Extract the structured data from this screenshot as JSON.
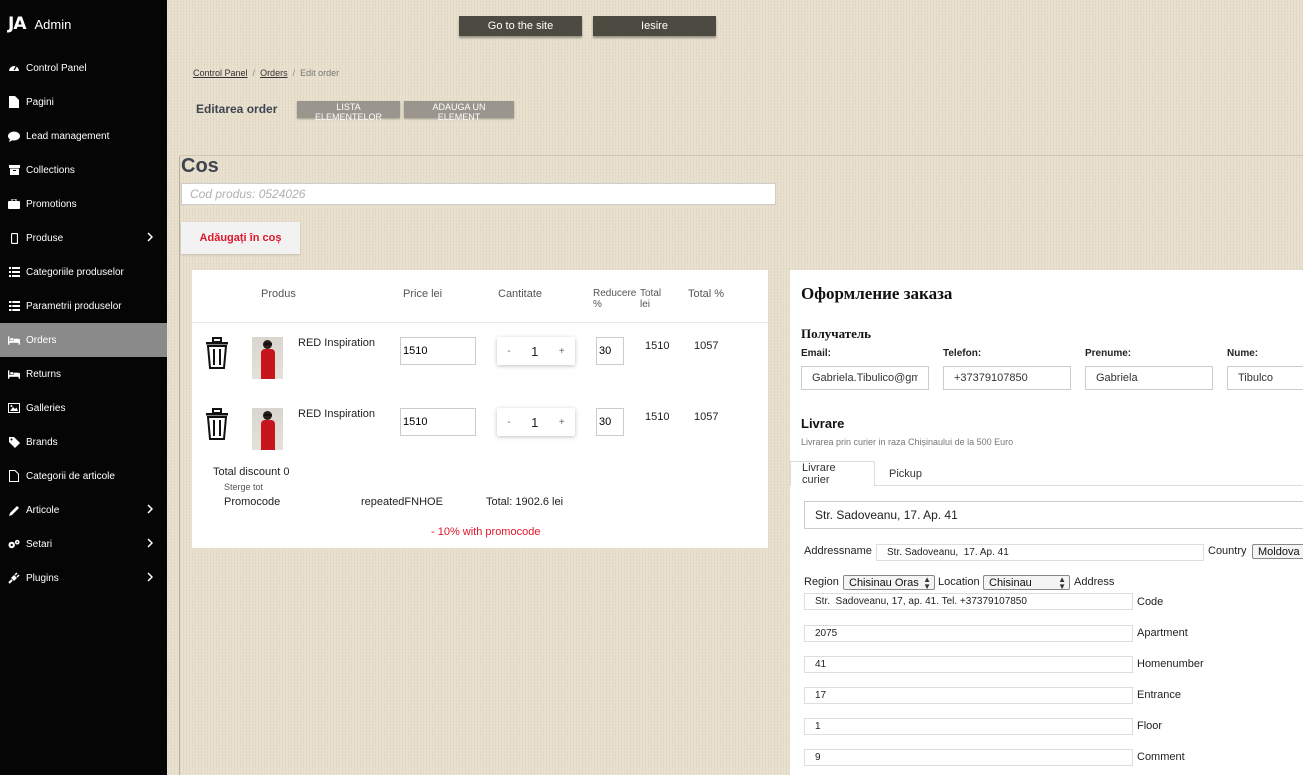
{
  "app": {
    "logo_mark": "JA",
    "title": "Admin"
  },
  "sidebar": {
    "items": [
      {
        "label": "Control Panel",
        "icon": "dashboard-icon",
        "active": false,
        "has_children": false
      },
      {
        "label": "Pagini",
        "icon": "file-icon",
        "active": false,
        "has_children": false
      },
      {
        "label": "Lead management",
        "icon": "comment-icon",
        "active": false,
        "has_children": false
      },
      {
        "label": "Collections",
        "icon": "archive-icon",
        "active": false,
        "has_children": false
      },
      {
        "label": "Promotions",
        "icon": "briefcase-icon",
        "active": false,
        "has_children": false
      },
      {
        "label": "Produse",
        "icon": "mobile-icon",
        "active": false,
        "has_children": true
      },
      {
        "label": "Categoriile produselor",
        "icon": "list-icon",
        "active": false,
        "has_children": false
      },
      {
        "label": "Parametrii produselor",
        "icon": "table-icon",
        "active": false,
        "has_children": false
      },
      {
        "label": "Orders",
        "icon": "bed-icon",
        "active": true,
        "has_children": false
      },
      {
        "label": "Returns",
        "icon": "bed-icon",
        "active": false,
        "has_children": false
      },
      {
        "label": "Galleries",
        "icon": "image-icon",
        "active": false,
        "has_children": false
      },
      {
        "label": "Brands",
        "icon": "tag-icon",
        "active": false,
        "has_children": false
      },
      {
        "label": "Categorii de articole",
        "icon": "file-outline-icon",
        "active": false,
        "has_children": false
      },
      {
        "label": "Articole",
        "icon": "pencil-icon",
        "active": false,
        "has_children": true
      },
      {
        "label": "Setari",
        "icon": "gears-icon",
        "active": false,
        "has_children": true
      },
      {
        "label": "Plugins",
        "icon": "plug-icon",
        "active": false,
        "has_children": true
      }
    ]
  },
  "topbar": {
    "site_btn": "Go to the site",
    "exit_btn": "Iesire"
  },
  "breadcrumb": {
    "home": "Control Panel",
    "section": "Orders",
    "current": "Edit order"
  },
  "header": {
    "title": "Editarea order",
    "list_btn": "LISTA ELEMENTELOR",
    "add_btn": "ADAUGA UN ELEMENT"
  },
  "cart": {
    "title": "Cos",
    "code_placeholder": "Cod produs: 0524026",
    "add_btn": "Adăugați în coș",
    "columns": {
      "product": "Produs",
      "price": "Price lei",
      "qty": "Cantitate",
      "discount": "Reducere %",
      "total": "Total lei",
      "total_pct": "Total %"
    },
    "rows": [
      {
        "name": "RED Inspiration",
        "price": "1510",
        "qty": "1",
        "discount": "30",
        "total": "1510",
        "total_pct": "1057"
      },
      {
        "name": "RED Inspiration",
        "price": "1510",
        "qty": "1",
        "discount": "30",
        "total": "1510",
        "total_pct": "1057"
      }
    ],
    "stepper": {
      "minus": "-",
      "plus": "+"
    },
    "total_discount": "Total discount 0",
    "clear_all": "Sterge tot",
    "promocode_label": "Promocode",
    "promocode_value": "repeatedFNHOE",
    "total": "Total: 1902.6 lei",
    "promo_note": "- 10% with promocode"
  },
  "order": {
    "title": "Оформление заказа",
    "recipient_title": "Получатель",
    "fields": {
      "email_label": "Email:",
      "email_value": "Gabriela.Tibulico@gmail.com",
      "phone_label": "Telefon:",
      "phone_value": "+37379107850",
      "firstname_label": "Prenume:",
      "firstname_value": "Gabriela",
      "lastname_label": "Nume:",
      "lastname_value": "Tibulco"
    },
    "delivery_title": "Livrare",
    "delivery_note": "Livrarea prin curier in raza Chișinaului de la 500 Euro",
    "tabs": [
      "Livrare curier",
      "Pickup"
    ],
    "address_main": "Str. Sadoveanu, 17. Ap. 41",
    "addressname_label": "Addressname",
    "addressname_value": "Str. Sadoveanu,  17. Ap. 41",
    "country_label": "Country",
    "country_value": "Moldova",
    "region_label": "Region",
    "region_value": "Chisinau Oras",
    "location_label": "Location",
    "location_value": "Chisinau",
    "address_label": "Address",
    "address_value": "Str.  Sadoveanu, 17, ap. 41. Tel. +37379107850",
    "code_label": "Code",
    "code_value": "2075",
    "apartment_label": "Apartment",
    "apartment_value": "41",
    "homenumber_label": "Homenumber",
    "homenumber_value": "17",
    "entrance_label": "Entrance",
    "entrance_value": "1",
    "floor_label": "Floor",
    "floor_value": "9",
    "comment_label": "Comment"
  }
}
